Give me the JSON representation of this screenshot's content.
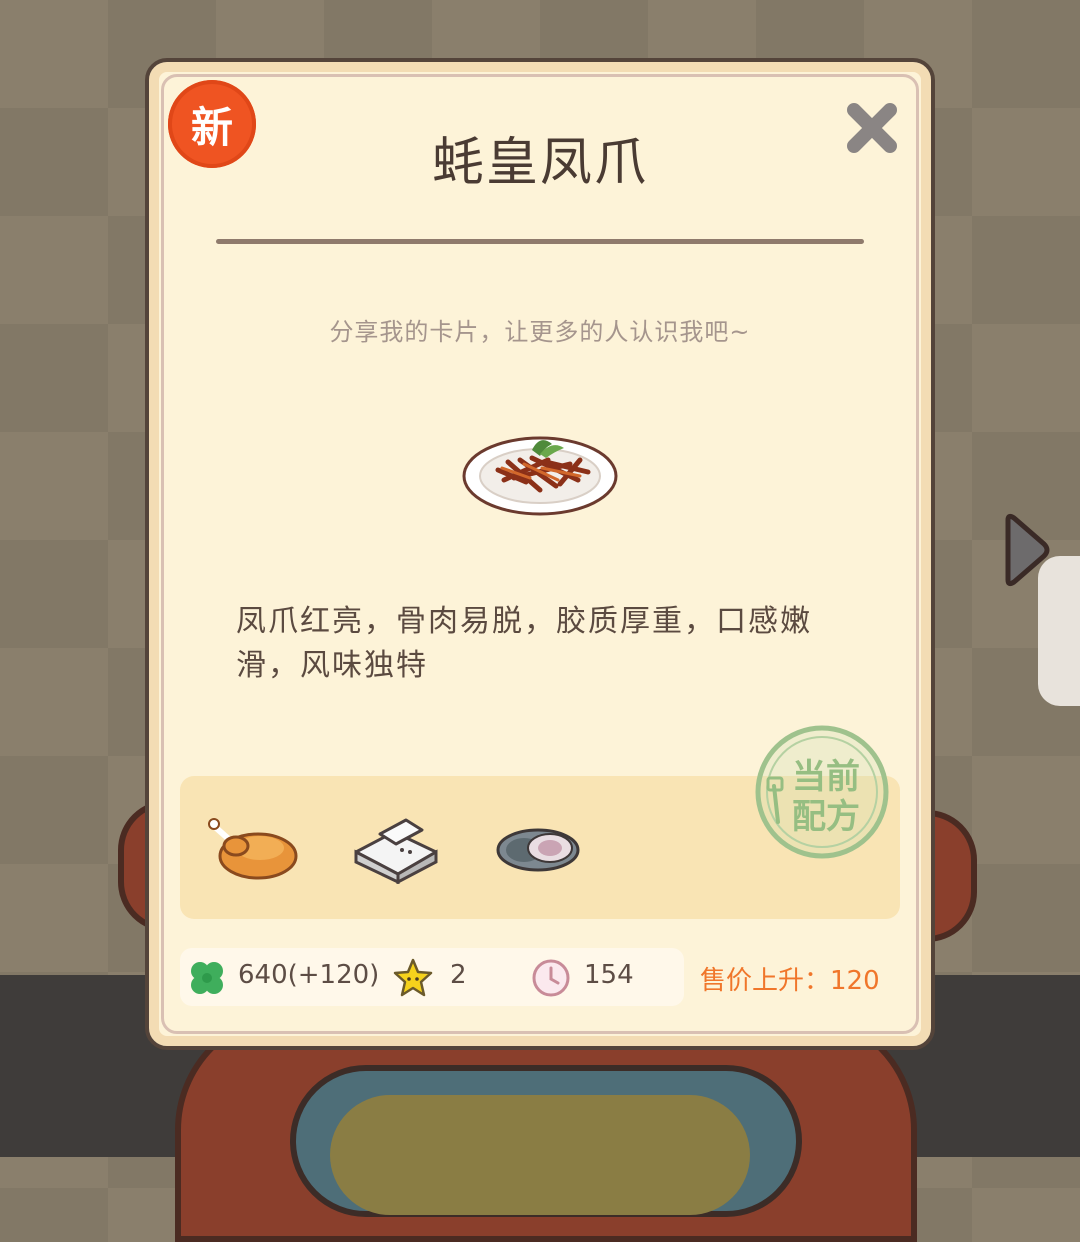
{
  "card": {
    "badge": "新",
    "title": "蚝皇凤爪",
    "share_hint": "分享我的卡片，让更多的人认识我吧~",
    "description": "凤爪红亮，骨肉易脱，胶质厚重，口感嫩滑，风味独特",
    "ingredients": [
      {
        "icon": "roast-chicken-icon"
      },
      {
        "icon": "tofu-icon"
      },
      {
        "icon": "oyster-icon"
      }
    ],
    "stamp_text": "当前配方",
    "stats": {
      "clover_value": "640(+120)",
      "star_value": "2",
      "time_value": "154"
    },
    "price_rise": "售价上升：120"
  },
  "colors": {
    "card_bg": "#fdf3d8",
    "badge": "#ef5422",
    "price": "#f0762b",
    "clover": "#3fae5c",
    "star": "#f5d21c"
  }
}
